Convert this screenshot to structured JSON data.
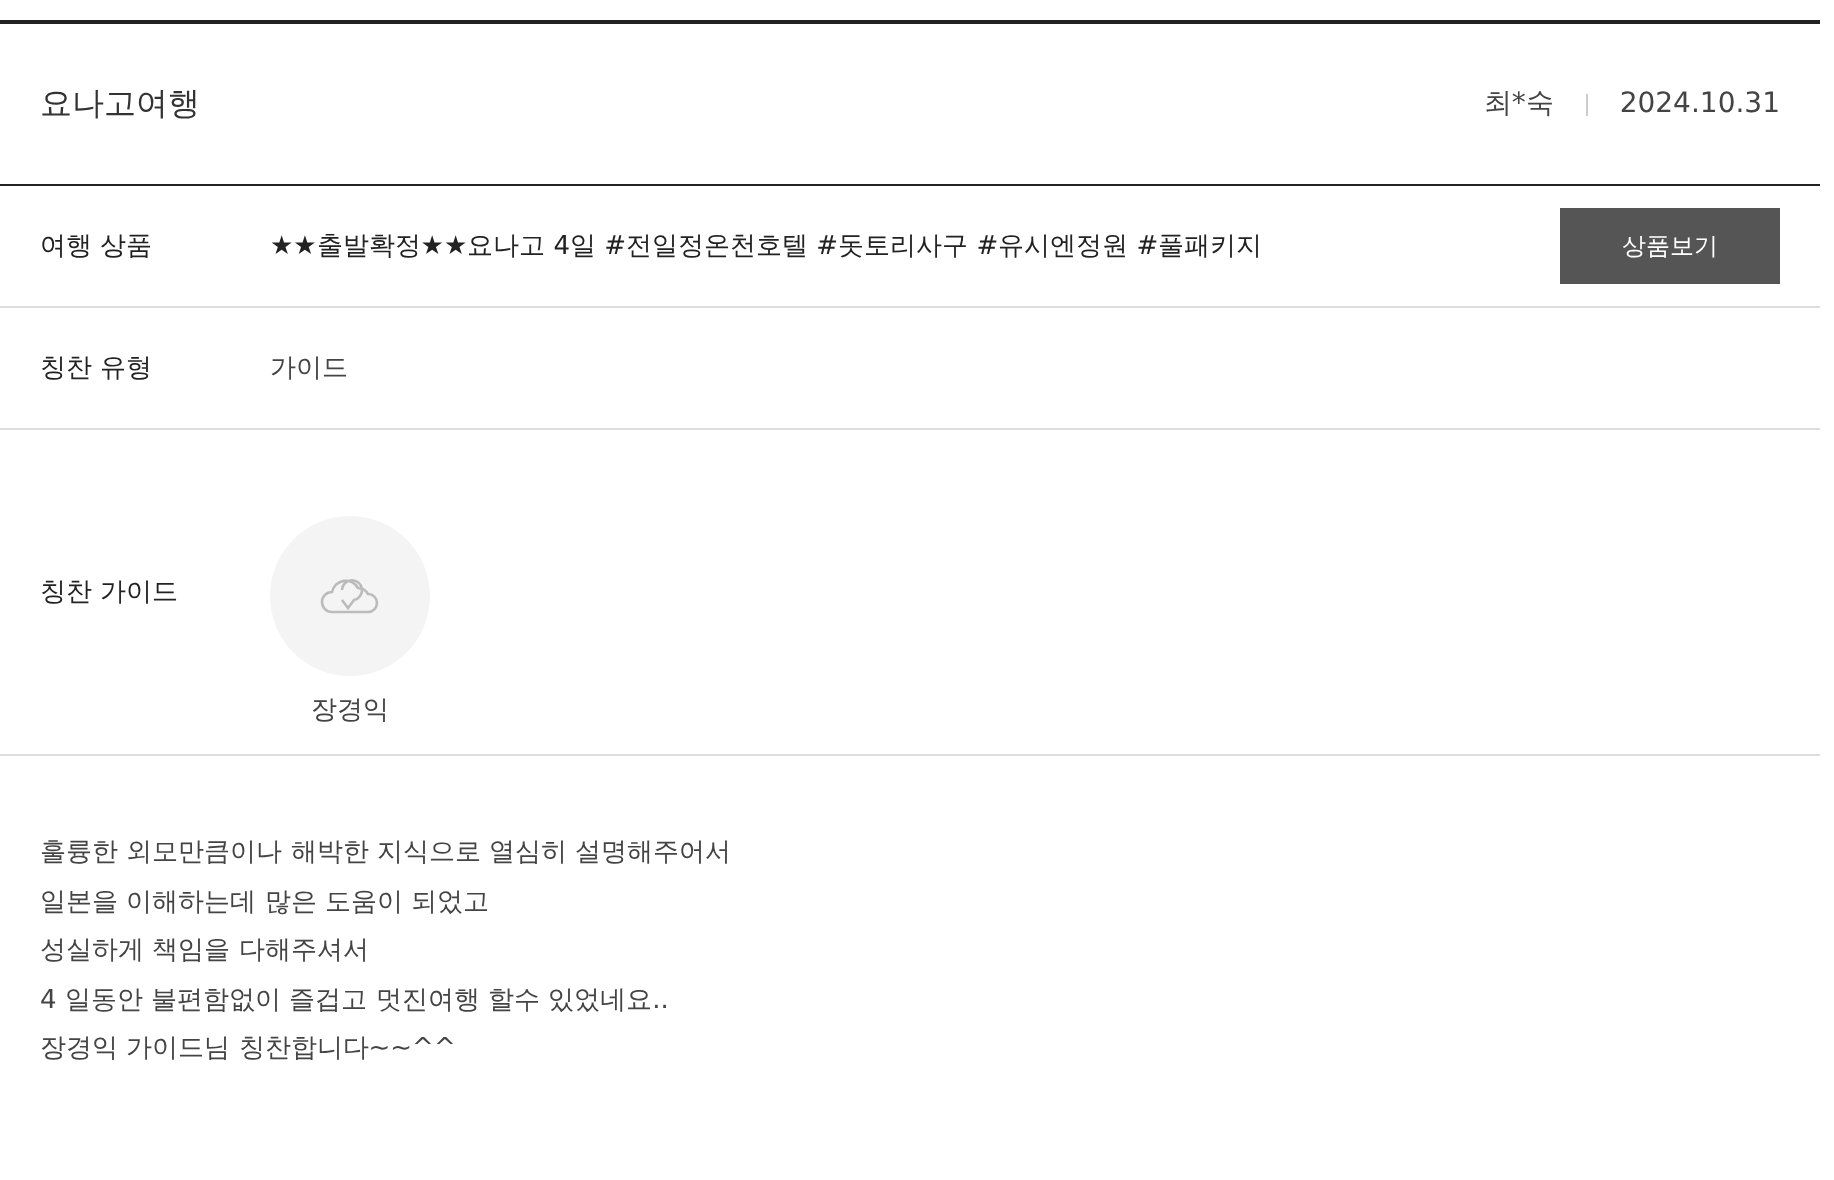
{
  "header": {
    "title": "요나고여행",
    "author": "최*숙",
    "date": "2024.10.31"
  },
  "rows": [
    {
      "kind": "product",
      "label": "여행 상품",
      "value": "★★출발확정★★요나고 4일 #전일정온천호텔 #돗토리사구 #유시엔정원 #풀패키지",
      "button": "상품보기"
    },
    {
      "kind": "text",
      "label": "칭찬 유형",
      "value": "가이드"
    },
    {
      "kind": "guide",
      "label": "칭찬 가이드",
      "guides": [
        {
          "name": "장경익"
        }
      ]
    }
  ],
  "body": [
    "훌륭한 외모만큼이나 해박한 지식으로 열심히 설명해주어서",
    "일본을 이해하는데 많은 도움이 되었고",
    "성실하게 책임을 다해주셔서",
    "4 일동안 불편함없이 즐겁고 멋진여행 할수 있었네요..",
    "장경익 가이드님 칭찬합니다~~^^"
  ]
}
